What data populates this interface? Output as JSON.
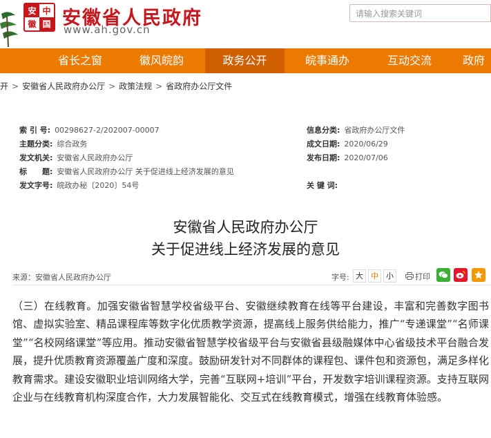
{
  "header": {
    "seal_chars": [
      "安",
      "中",
      "徽",
      "国"
    ],
    "site_name": "安徽省人民政府",
    "site_url": "www.ah.gov.cn",
    "search_placeholder": "请输入搜索关键词",
    "brand_color": "#c8161d"
  },
  "nav": {
    "items": [
      "省长之窗",
      "徽风皖韵",
      "政务公开",
      "皖事通办",
      "互动交流",
      "政府"
    ],
    "active": "政务公开",
    "color": "#ec7a00"
  },
  "breadcrumb": [
    "开",
    "安徽省人民政府办公厅",
    "政策法规",
    "省政府办公厅文件"
  ],
  "meta": {
    "index_no_label": "索 引 号:",
    "index_no": "00298627-2/202007-00007",
    "info_class_label": "信息分类:",
    "info_class": "省政府办公厅文件",
    "topic_label": "主题分类:",
    "topic": "综合政务",
    "created_label": "成文日期:",
    "created": "2020/06/29",
    "issuer_label": "发文机关:",
    "issuer": "安徽省人民政府办公厅",
    "published_label": "发布日期:",
    "published": "2020/07/06",
    "title_label": "标　　题:",
    "title": "安徽省人民政府办公厅 关于促进线上经济发展的意见",
    "doc_no_label": "发文字号:",
    "doc_no": "皖政办秘〔2020〕54号",
    "keywords_label": "关 键 词:"
  },
  "article": {
    "title_line1": "安徽省人民政府办公厅",
    "title_line2": "关于促进线上经济发展的意见",
    "source": "来源：安徽省人民政府办公厅",
    "font_size_label": "字号:",
    "font_sizes": [
      "大",
      "中",
      "小"
    ],
    "print_label": "打印",
    "share_icons": [
      "wechat-icon",
      "weibo-icon",
      "favorite-icon"
    ],
    "body": "（三）在线教育。加强安徽省智慧学校省级平台、安徽继续教育在线等平台建设，丰富和完善数字图书馆、虚拟实验室、精品课程库等数字化优质教学资源，提高线上服务供给能力，推广“专递课堂”“名师课堂”“名校网络课堂”等应用。推动安徽省智慧学校省级平台与安徽省县级融媒体中心省级技术平台融合发展，提升优质教育资源覆盖广度和深度。鼓励研发针对不同群体的课程包、课件包和资源包，满足多样化教育需求。建设安徽职业培训网络大学，完善“互联网+培训”平台，开发数字培训课程资源。支持互联网企业与在线教育机构深度合作，大力发展智能化、交互式在线教育模式，增强在线教育体验感。"
  }
}
